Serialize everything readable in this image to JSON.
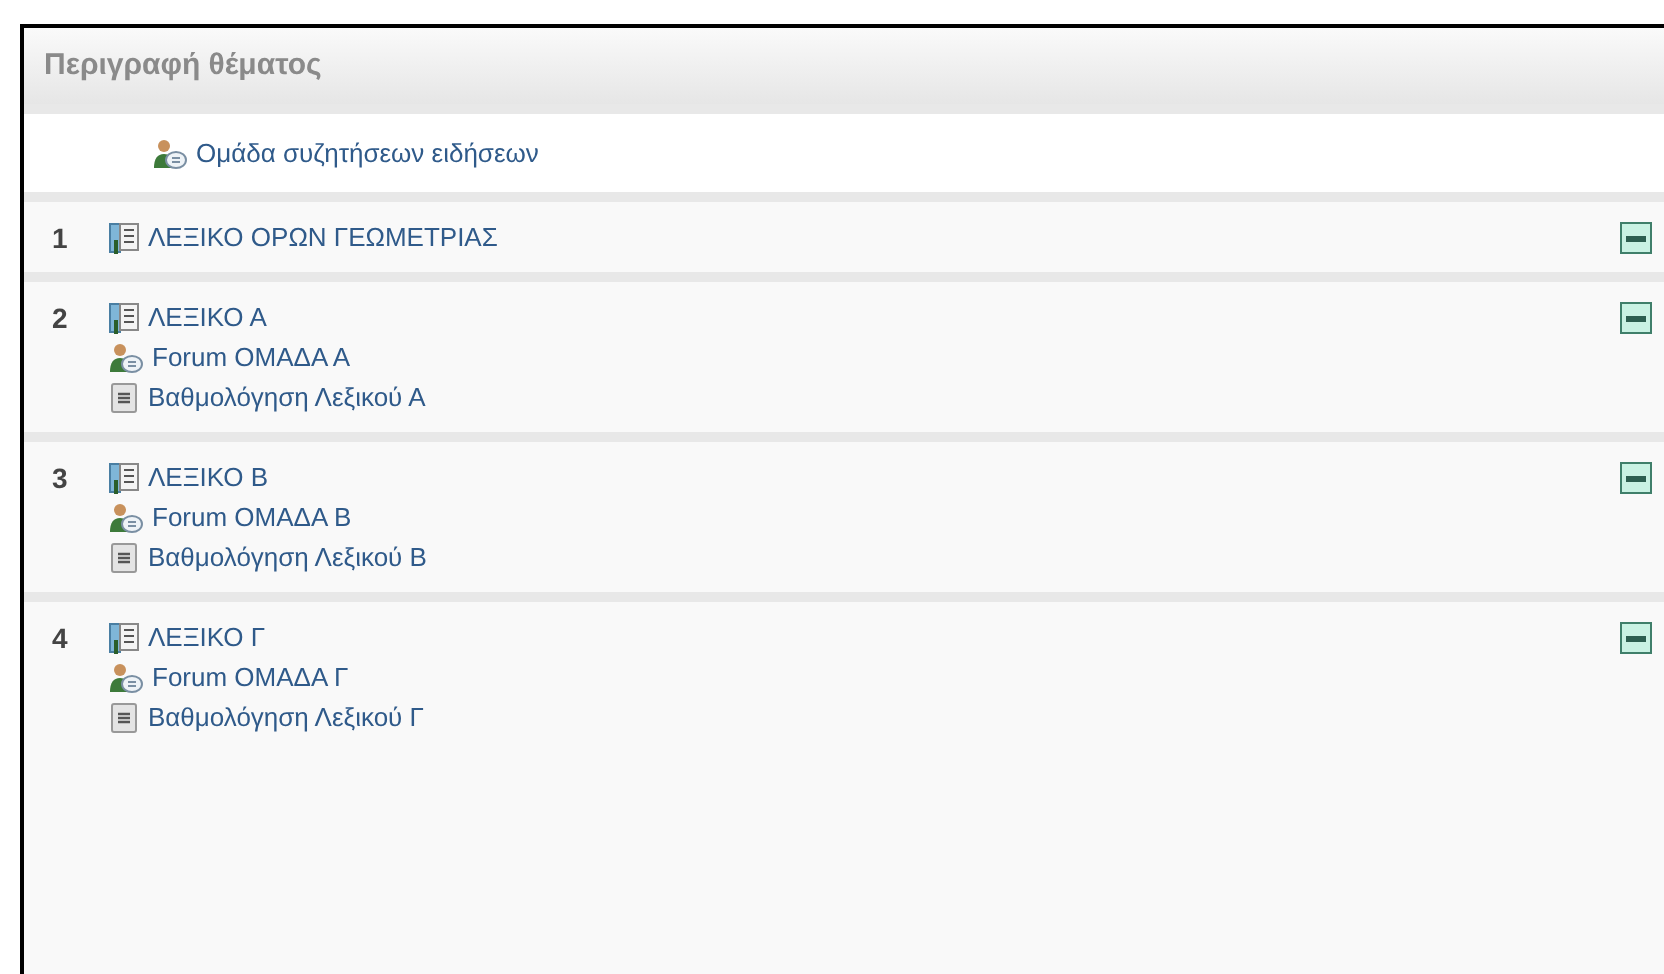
{
  "header": {
    "title": "Περιγραφή θέματος"
  },
  "general_section": {
    "items": [
      {
        "kind": "forum",
        "label": "Ομάδα συζητήσεων ειδήσεων"
      }
    ]
  },
  "sections": [
    {
      "number": "1",
      "expanded": true,
      "items": [
        {
          "kind": "glossary",
          "label": "ΛΕΞΙΚΟ ΟΡΩΝ ΓΕΩΜΕΤΡΙΑΣ"
        }
      ]
    },
    {
      "number": "2",
      "expanded": true,
      "items": [
        {
          "kind": "glossary",
          "label": "ΛΕΞΙΚΟ Α"
        },
        {
          "kind": "forum",
          "label": "Forum ΟΜΑΔΑ Α"
        },
        {
          "kind": "assignment",
          "label": "Βαθμολόγηση Λεξικού Α"
        }
      ]
    },
    {
      "number": "3",
      "expanded": true,
      "items": [
        {
          "kind": "glossary",
          "label": "ΛΕΞΙΚΟ Β"
        },
        {
          "kind": "forum",
          "label": "Forum ΟΜΑΔΑ Β"
        },
        {
          "kind": "assignment",
          "label": "Βαθμολόγηση Λεξικού Β"
        }
      ]
    },
    {
      "number": "4",
      "expanded": true,
      "items": [
        {
          "kind": "glossary",
          "label": "ΛΕΞΙΚΟ Γ"
        },
        {
          "kind": "forum",
          "label": "Forum ΟΜΑΔΑ Γ"
        },
        {
          "kind": "assignment",
          "label": "Βαθμολόγηση Λεξικού Γ"
        }
      ]
    }
  ]
}
